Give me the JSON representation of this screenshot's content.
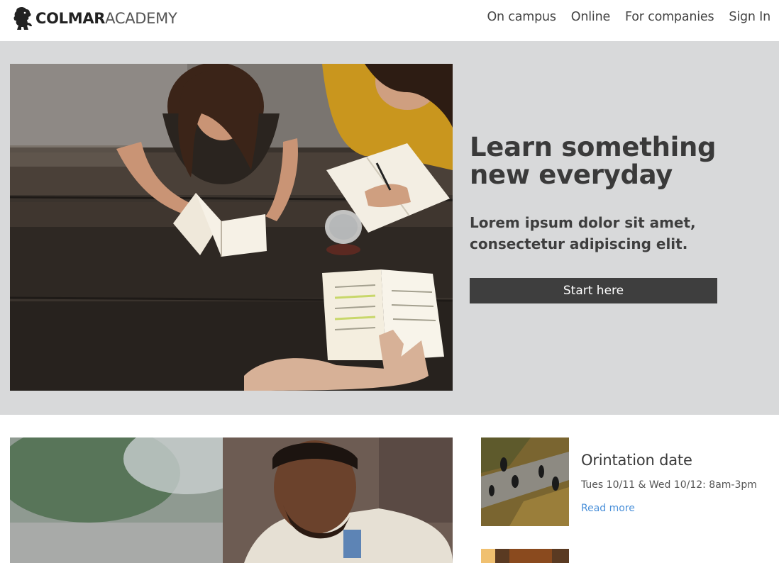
{
  "header": {
    "logo_bold": "COLMAR",
    "logo_light": "ACADEMY",
    "logo_icon": "lion-icon",
    "nav": [
      {
        "label": "On campus"
      },
      {
        "label": "Online"
      },
      {
        "label": "For companies"
      },
      {
        "label": "Sign In"
      }
    ]
  },
  "hero": {
    "title": "Learn something new everyday",
    "subtitle": "Lorem ipsum dolor sit amet, consectetur adipiscing elit.",
    "button_label": "Start here"
  },
  "events": [
    {
      "title": "Orintation date",
      "date": "Tues 10/11 & Wed 10/12: 8am-3pm",
      "link_label": "Read more"
    }
  ],
  "colors": {
    "hero_bg": "#d8d9da",
    "button_bg": "#3e3e3e",
    "link": "#4a90d9"
  }
}
